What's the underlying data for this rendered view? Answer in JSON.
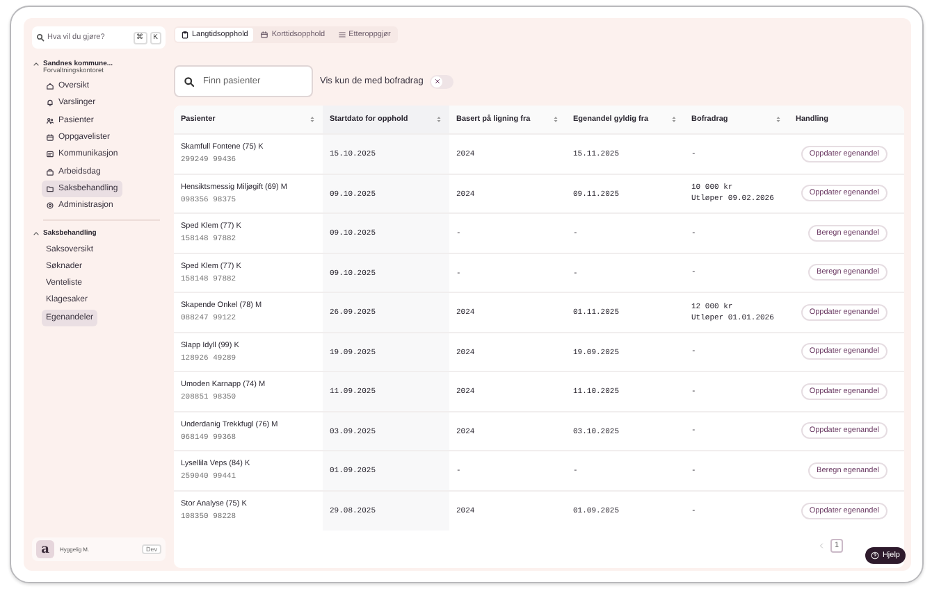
{
  "sidebar": {
    "search": {
      "placeholder": "Hva vil du gjøre?",
      "keys": [
        "⌘",
        "K"
      ]
    },
    "org": {
      "name": "Sandnes kommune...",
      "unit": "Forvaltningskontoret",
      "expanded": true
    },
    "items": [
      {
        "label": "Oversikt",
        "selected": false
      },
      {
        "label": "Varslinger",
        "selected": false
      },
      {
        "label": "Pasienter",
        "selected": false
      },
      {
        "label": "Oppgavelister",
        "selected": false
      },
      {
        "label": "Kommunikasjon",
        "selected": false
      },
      {
        "label": "Arbeidsdag",
        "selected": false
      },
      {
        "label": "Saksbehandling",
        "selected": true
      },
      {
        "label": "Administrasjon",
        "selected": false
      }
    ],
    "section": {
      "title": "Saksbehandling",
      "expanded": true,
      "items": [
        {
          "label": "Saksoversikt",
          "selected": false
        },
        {
          "label": "Søknader",
          "selected": false
        },
        {
          "label": "Venteliste",
          "selected": false
        },
        {
          "label": "Klagesaker",
          "selected": false
        },
        {
          "label": "Egenandeler",
          "selected": true
        }
      ]
    },
    "user": {
      "avatar": "a",
      "name": "Hyggelig M.",
      "badge": "Dev"
    }
  },
  "tabs": [
    {
      "label": "Langtidsopphold",
      "selected": true
    },
    {
      "label": "Korttidsopphold",
      "selected": false
    },
    {
      "label": "Etteroppgjør",
      "selected": false
    }
  ],
  "search": {
    "placeholder": "Finn pasienter"
  },
  "filter": {
    "label": "Vis kun de med bofradrag",
    "on": false
  },
  "table": {
    "columns": [
      {
        "label": "Pasienter",
        "sortable": true,
        "sorted": false
      },
      {
        "label": "Startdato for opphold",
        "sortable": true,
        "sorted": true
      },
      {
        "label": "Basert på ligning fra",
        "sortable": true,
        "sorted": false
      },
      {
        "label": "Egenandel gyldig fra",
        "sortable": true,
        "sorted": false
      },
      {
        "label": "Bofradrag",
        "sortable": true,
        "sorted": false
      },
      {
        "label": "Handling",
        "sortable": false,
        "sorted": false
      }
    ],
    "rows": [
      {
        "name": "Skamfull Fontene (75) K",
        "id": "299249 99436",
        "start": "15.10.2025",
        "basis": "2024",
        "valid_from": "15.11.2025",
        "deduction": [
          "-"
        ],
        "action": "Oppdater egenandel"
      },
      {
        "name": "Hensiktsmessig Miljøgift (69) M",
        "id": "098356 98375",
        "start": "09.10.2025",
        "basis": "2024",
        "valid_from": "09.11.2025",
        "deduction": [
          "10 000 kr",
          "Utløper 09.02.2026"
        ],
        "action": "Oppdater egenandel"
      },
      {
        "name": "Sped Klem (77) K",
        "id": "158148 97882",
        "start": "09.10.2025",
        "basis": "-",
        "valid_from": "-",
        "deduction": [
          "-"
        ],
        "action": "Beregn egenandel"
      },
      {
        "name": "Sped Klem (77) K",
        "id": "158148 97882",
        "start": "09.10.2025",
        "basis": "-",
        "valid_from": "-",
        "deduction": [
          "-"
        ],
        "action": "Beregn egenandel"
      },
      {
        "name": "Skapende Onkel (78) M",
        "id": "088247 99122",
        "start": "26.09.2025",
        "basis": "2024",
        "valid_from": "01.11.2025",
        "deduction": [
          "12 000 kr",
          "Utløper 01.01.2026"
        ],
        "action": "Oppdater egenandel"
      },
      {
        "name": "Slapp Idyll (99) K",
        "id": "128926 49289",
        "start": "19.09.2025",
        "basis": "2024",
        "valid_from": "19.09.2025",
        "deduction": [
          "-"
        ],
        "action": "Oppdater egenandel"
      },
      {
        "name": "Umoden Karnapp (74) M",
        "id": "208851 98350",
        "start": "11.09.2025",
        "basis": "2024",
        "valid_from": "11.10.2025",
        "deduction": [
          "-"
        ],
        "action": "Oppdater egenandel"
      },
      {
        "name": "Underdanig Trekkfugl (76) M",
        "id": "068149 99368",
        "start": "03.09.2025",
        "basis": "2024",
        "valid_from": "03.10.2025",
        "deduction": [
          "-"
        ],
        "action": "Oppdater egenandel"
      },
      {
        "name": "Lysellila Veps (84) K",
        "id": "259040 99441",
        "start": "01.09.2025",
        "basis": "-",
        "valid_from": "-",
        "deduction": [
          "-"
        ],
        "action": "Beregn egenandel"
      },
      {
        "name": "Stor Analyse (75) K",
        "id": "108350 98228",
        "start": "29.08.2025",
        "basis": "2024",
        "valid_from": "01.09.2025",
        "deduction": [
          "-"
        ],
        "action": "Oppdater egenandel"
      }
    ]
  },
  "pagination": {
    "pages": [
      {
        "label": "1",
        "selected": true
      }
    ]
  },
  "help": {
    "label": "Hjelp"
  }
}
